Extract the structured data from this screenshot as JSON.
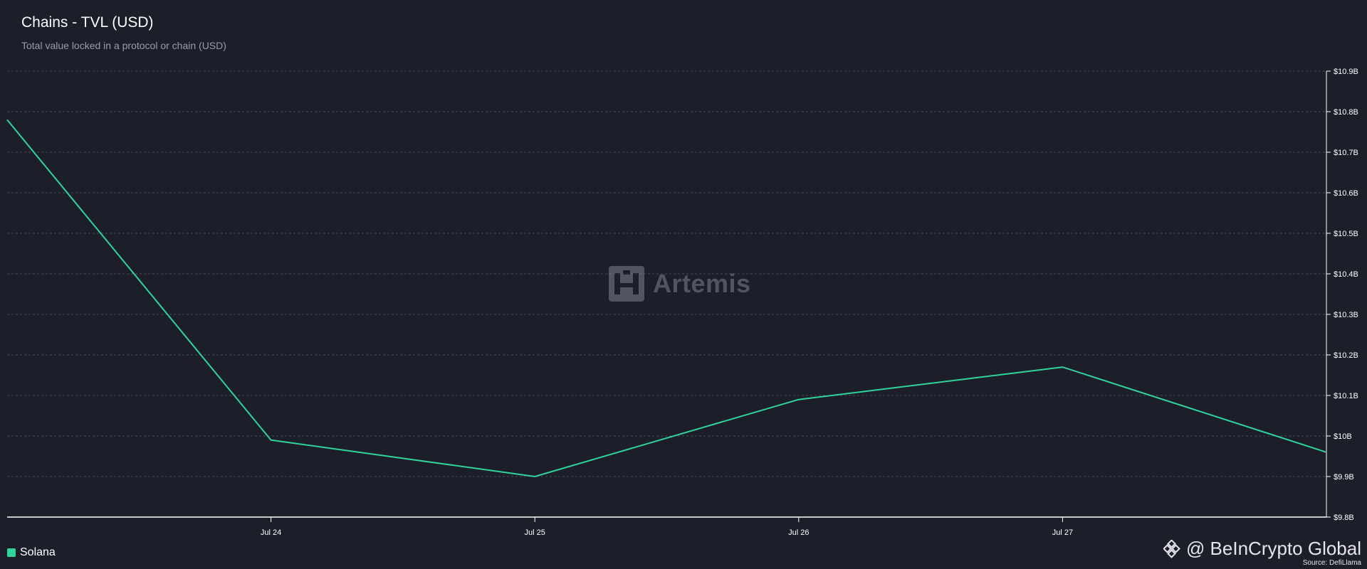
{
  "header": {
    "title": "Chains - TVL (USD)",
    "subtitle": "Total value locked in a protocol or chain (USD)"
  },
  "watermark": {
    "text": "Artemis",
    "icon": "artemis-logo-icon"
  },
  "branding": {
    "text": "@ BeInCrypto Global",
    "icon": "beincrypto-diamond-icon",
    "source": "Source: DefiLlama"
  },
  "colors": {
    "background": "#1c1e29",
    "series": "#2fd59a",
    "grid": "#4a4d5a",
    "axis": "#ffffff"
  },
  "chart_data": {
    "type": "line",
    "x": [
      "Jul 23",
      "Jul 24",
      "Jul 25",
      "Jul 26",
      "Jul 27",
      "Jul 28"
    ],
    "x_tick_labels": [
      "Jul 24",
      "Jul 25",
      "Jul 26",
      "Jul 27"
    ],
    "x_range": [
      "Jul 23",
      "Jul 28"
    ],
    "series": [
      {
        "name": "Solana",
        "values": [
          10.78,
          9.99,
          9.9,
          10.09,
          10.17,
          9.96
        ]
      }
    ],
    "y_tick_labels": [
      "$9.8B",
      "$9.9B",
      "$10B",
      "$10.1B",
      "$10.2B",
      "$10.3B",
      "$10.4B",
      "$10.5B",
      "$10.6B",
      "$10.7B",
      "$10.8B",
      "$10.9B"
    ],
    "ylim": [
      9.8,
      10.9
    ],
    "y_unit": "USD billions",
    "y_axis_position": "right",
    "grid": true,
    "legend_position": "bottom-left"
  }
}
